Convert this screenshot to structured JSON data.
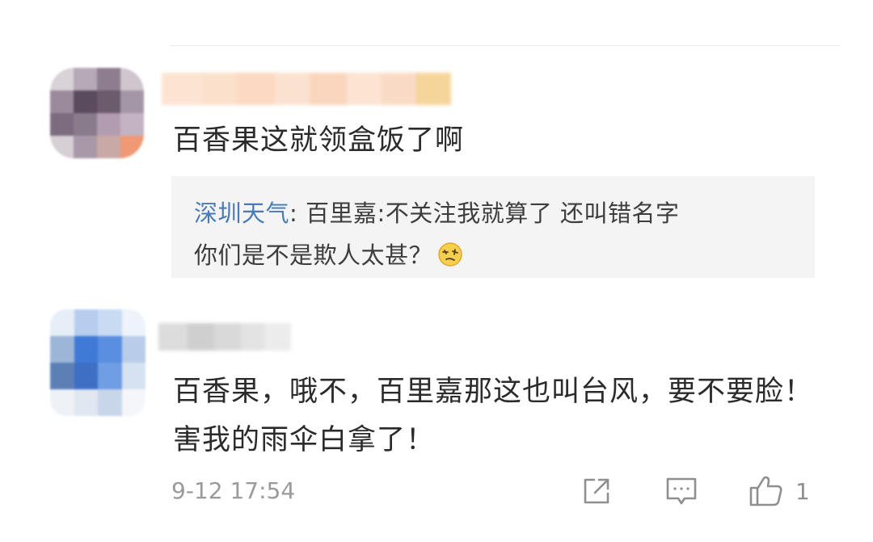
{
  "comments": [
    {
      "text": "百香果这就领盒饭了啊",
      "quote": {
        "user": "深圳天气",
        "separator": ": ",
        "line1": "百里嘉:不关注我就算了 还叫错名字",
        "line2": "你们是不是欺人太甚？"
      }
    },
    {
      "text": "百香果，哦不，百里嘉那这也叫台风，要不要脸！害我的雨伞白拿了！",
      "timestamp": "9-12 17:54",
      "likes": "1"
    }
  ],
  "icons": {
    "share": "share-icon",
    "comment": "comment-icon",
    "like": "thumbs-up-icon",
    "quote_emoji": "dizzy-face-emoji"
  },
  "colors": {
    "text": "#2b2b2b",
    "quote_user": "#4a7ab4",
    "quote_bg": "#f4f4f4",
    "meta": "#9a9a9a"
  }
}
